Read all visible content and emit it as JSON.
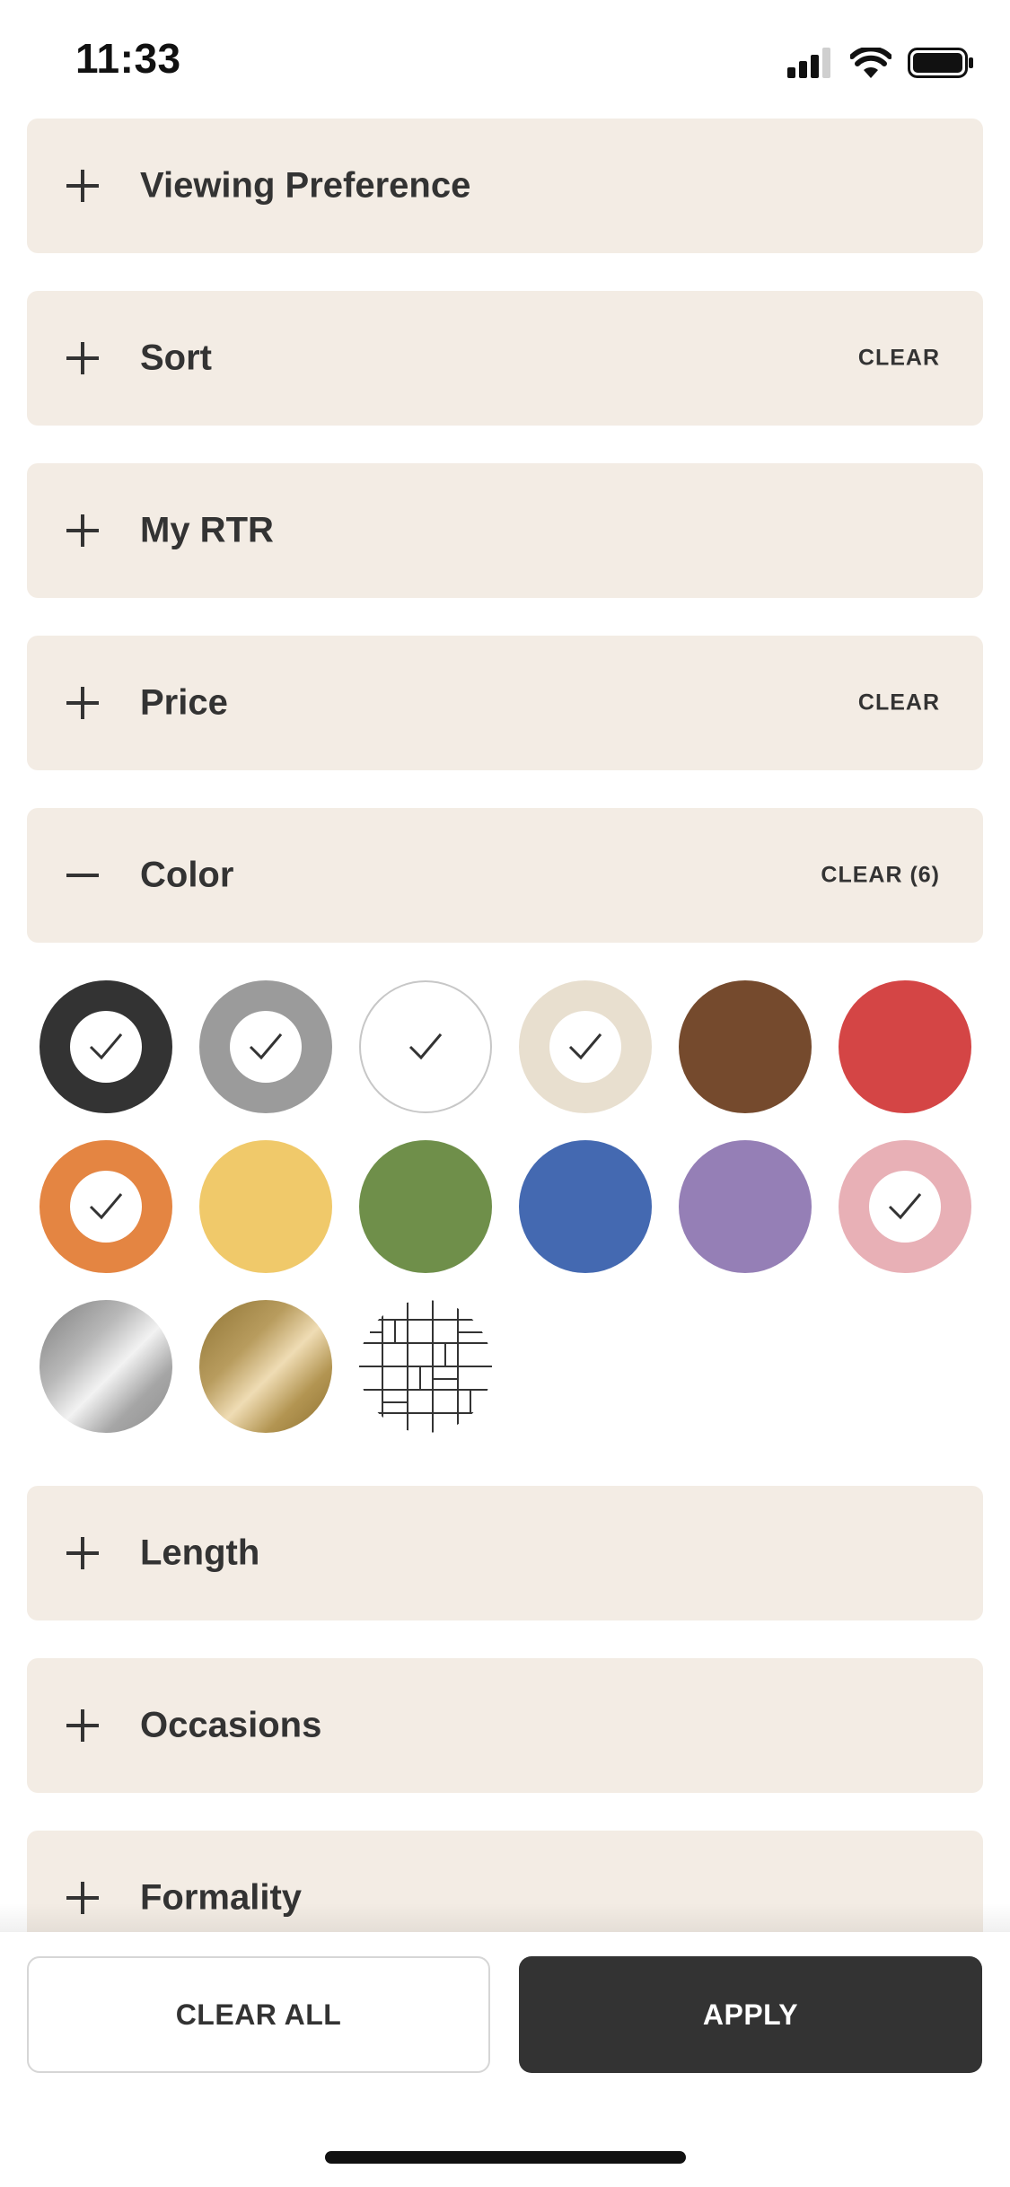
{
  "status_bar": {
    "time": "11:33",
    "icons": [
      "cellular-signal-icon",
      "wifi-icon",
      "battery-icon"
    ]
  },
  "panels": {
    "viewing_preference": {
      "title": "Viewing Preference",
      "state": "collapsed",
      "icon": "plus-icon"
    },
    "sort": {
      "title": "Sort",
      "state": "collapsed",
      "icon": "plus-icon",
      "clear_label": "CLEAR"
    },
    "my_rtr": {
      "title": "My RTR",
      "state": "collapsed",
      "icon": "plus-icon"
    },
    "price": {
      "title": "Price",
      "state": "collapsed",
      "icon": "plus-icon",
      "clear_label": "CLEAR"
    },
    "color": {
      "title": "Color",
      "state": "expanded",
      "icon": "minus-icon",
      "clear_label": "CLEAR (6)"
    },
    "length": {
      "title": "Length",
      "state": "collapsed",
      "icon": "plus-icon"
    },
    "occasions": {
      "title": "Occasions",
      "state": "collapsed",
      "icon": "plus-icon"
    },
    "formality": {
      "title": "Formality",
      "state": "collapsed",
      "icon": "plus-icon"
    }
  },
  "colors": {
    "swatches": [
      {
        "color": "#333333",
        "selected": true
      },
      {
        "color": "#9b9b9b",
        "selected": true
      },
      {
        "color": "#ffffff",
        "selected": true
      },
      {
        "color": "#e8dfcf",
        "selected": true
      },
      {
        "color": "#754a2d",
        "selected": false
      },
      {
        "color": "#d44545",
        "selected": false
      },
      {
        "color": "#e48542",
        "selected": true
      },
      {
        "color": "#f0c96a",
        "selected": false
      },
      {
        "color": "#6f8f4a",
        "selected": false
      },
      {
        "color": "#4469b1",
        "selected": false
      },
      {
        "color": "#957fb6",
        "selected": false
      },
      {
        "color": "#e8b0b6",
        "selected": true
      },
      {
        "color": "silver-gradient",
        "selected": false
      },
      {
        "color": "gold-gradient",
        "selected": false
      },
      {
        "color": "pattern",
        "selected": false
      }
    ]
  },
  "footer": {
    "clear_all_label": "CLEAR ALL",
    "apply_label": "APPLY"
  }
}
